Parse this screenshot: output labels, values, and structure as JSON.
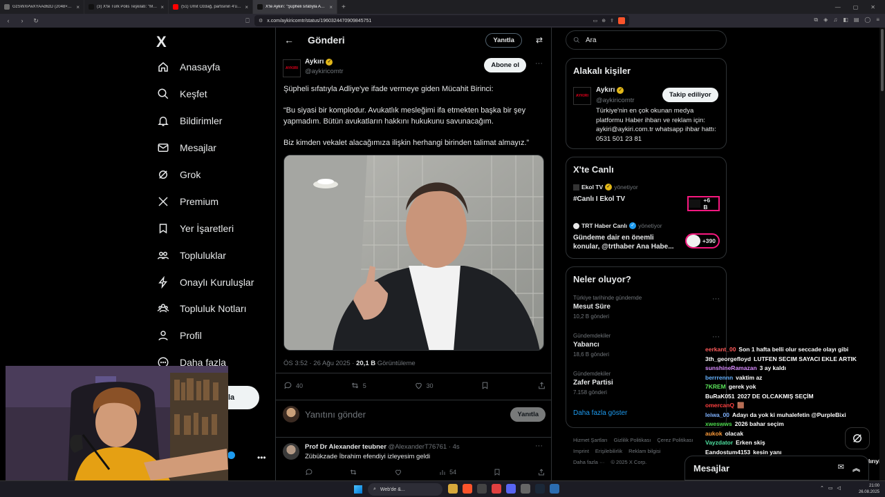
{
  "browser": {
    "tabs": [
      {
        "label": "GzSWXPwXYAAd6zD (2048×2048)",
        "icon_color": "#6b6b6b",
        "active": false
      },
      {
        "label": "(3) X'te Türk Polis Teşkilatı: \"Milletimi...",
        "icon_color": "#111111",
        "active": false
      },
      {
        "label": "(51) Ümit Özdağ, partisinin 4'ünc...",
        "icon_color": "#ff0000",
        "active": false
      },
      {
        "label": "X'te Aykırı: \"Şüpheli sıfatıyla Adli...",
        "icon_color": "#111111",
        "active": true
      }
    ],
    "url": "x.com/aykiricomtr/status/1960324470909845751"
  },
  "nav": {
    "logo": "X",
    "items": [
      {
        "label": "Anasayfa",
        "icon": "home-icon"
      },
      {
        "label": "Keşfet",
        "icon": "search-icon"
      },
      {
        "label": "Bildirimler",
        "icon": "bell-icon"
      },
      {
        "label": "Mesajlar",
        "icon": "mail-icon"
      },
      {
        "label": "Grok",
        "icon": "grok-icon"
      },
      {
        "label": "Premium",
        "icon": "x-logo-icon"
      },
      {
        "label": "Yer İşaretleri",
        "icon": "bookmark-icon"
      },
      {
        "label": "Topluluklar",
        "icon": "communities-icon"
      },
      {
        "label": "Onaylı Kuruluşlar",
        "icon": "lightning-icon"
      },
      {
        "label": "Topluluk Notları",
        "icon": "notes-icon"
      },
      {
        "label": "Profil",
        "icon": "person-icon"
      },
      {
        "label": "Daha fazla",
        "icon": "more-icon"
      }
    ],
    "post_fragment": "la"
  },
  "header": {
    "title": "Gönderi",
    "reply_btn": "Yanıtla"
  },
  "tweet": {
    "name": "Aykırı",
    "handle": "@aykiricomtr",
    "avatar_text": "AYKIRI",
    "subscribe_btn": "Abone ol",
    "paragraphs": [
      "Şüpheli sıfatıyla Adliye'ye ifade vermeye giden Mücahit Birinci:",
      "“Bu siyasi bir komplodur. Avukatlık mesleğimi ifa etmekten başka bir şey yapmadım. Bütün avukatların hakkını hukukunu savunacağım.",
      "Biz kimden vekalet alacağımıza ilişkin herhangi birinden talimat almayız.”"
    ],
    "time": "ÖS 3:52 · 26 Ağu 2025 · ",
    "views": "20,1 B",
    "views_label": " Görüntüleme",
    "replies": "40",
    "reposts": "5",
    "likes": "30"
  },
  "reply_box": {
    "placeholder": "Yanıtını gönder",
    "button": "Yanıtla"
  },
  "reply": {
    "name": "Prof Dr Alexander teubner",
    "handle": "@AlexanderT76761 · 4s",
    "text": "Zübükzade İbrahim efendiyi izleyesim geldi",
    "views": "54"
  },
  "search": {
    "placeholder": "Ara"
  },
  "related": {
    "title": "Alakalı kişiler",
    "name": "Aykırı",
    "handle": "@aykiricomtr",
    "follow_btn": "Takip ediliyor",
    "bio": "Türkiye'nin en çok okunan medya platformu Haber ihbarı ve reklam için: aykiri@aykiri.com.tr whatsapp ihbar hattı: 0531 501 23 81"
  },
  "live": {
    "title": "X'te Canlı",
    "items": [
      {
        "channel": "Ekol TV",
        "role": "yönetiyor",
        "title": "#Canlı I Ekol TV",
        "count": "+6 B"
      },
      {
        "channel": "TRT Haber Canlı",
        "role": "yönetiyor",
        "title": "Gündeme dair en önemli konular, @trthaber Ana Habe...",
        "count": "+390"
      }
    ]
  },
  "trends": {
    "title": "Neler oluyor?",
    "items": [
      {
        "category": "Türkiye tarihinde gündemde",
        "topic": "Mesut Süre",
        "count": "10,2 B gönderi"
      },
      {
        "category": "Gündemdekiler",
        "topic": "Yabancı",
        "count": "18,6 B gönderi"
      },
      {
        "category": "Gündemdekiler",
        "topic": "Zafer Partisi",
        "count": "7.158 gönderi"
      }
    ],
    "show_more": "Daha fazla göster"
  },
  "footer": {
    "links": [
      "Hizmet Şartları",
      "Gizlilik Politikası",
      "Çerez Politikası",
      "Imprint",
      "Erişilebilirlik",
      "Reklam bilgisi",
      "Daha fazla ···",
      "© 2025 X Corp."
    ]
  },
  "chat": [
    {
      "user": "eerkant_00",
      "color": "#ff5a5a",
      "msg": "Son 1 hafta belli olur seccade olayı gibi"
    },
    {
      "user": "3th_georgefloyd",
      "color": "#ffffff",
      "msg": "LUTFEN SECIM SAYACI EKLE ARTIK"
    },
    {
      "user": "sunshineRamazan",
      "color": "#d98cff",
      "msg": "3 ay kaldı"
    },
    {
      "user": "berrrennn",
      "color": "#66b3ff",
      "msg": "vaktim az"
    },
    {
      "user": "7KREM",
      "color": "#5ce65c",
      "msg": "gerek yok"
    },
    {
      "user": "BuRaK051",
      "color": "#ffffff",
      "msg": "2027 DE OLCAKMIŞ SEÇİM"
    },
    {
      "user": "omercanQ",
      "color": "#ff4040",
      "msg": "🟫"
    },
    {
      "user": "leiwa_00",
      "color": "#7fb2ff",
      "msg": "Adayı da yok ki muhalefetin @PurpleBixi"
    },
    {
      "user": "xweswws",
      "color": "#4dd94d",
      "msg": "2026 bahar seçim"
    },
    {
      "user": "aukok",
      "color": "#ff9c3a",
      "msg": "olacak"
    },
    {
      "user": "Vayzdator",
      "color": "#4ee0a0",
      "msg": "Erken skiş"
    },
    {
      "user": "Eandostum4153",
      "color": "#ffffff",
      "msg": "kesin yanı"
    },
    {
      "user": "ebeninkii",
      "color": "#4dd94d",
      "msg": "mansur yada eko aday değilse bi sikolmaz akp alırıyine"
    }
  ],
  "dm": {
    "label": "Mesajlar"
  },
  "taskbar": {
    "search": "Web'de &...",
    "time": "21:00",
    "date": "26.08.2025"
  }
}
